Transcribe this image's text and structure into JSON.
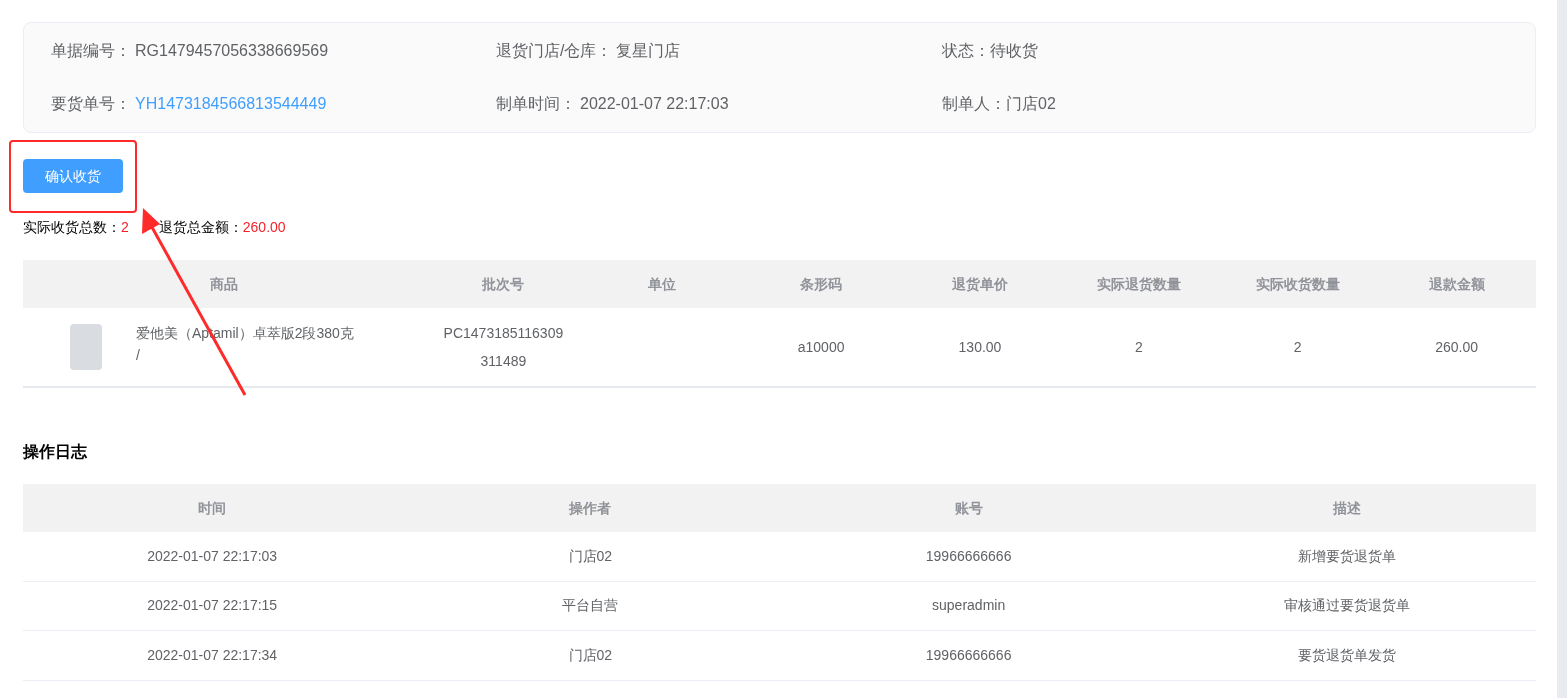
{
  "info": [
    {
      "label": "单据编号：",
      "value": "RG1479457056338669569",
      "kind": "plain"
    },
    {
      "label": "退货门店/仓库：",
      "value": "复星门店",
      "kind": "plain"
    },
    {
      "label": "状态：",
      "value": "待收货",
      "kind": "plain"
    },
    {
      "label": "要货单号：",
      "value": "YH1473184566813544449",
      "kind": "link"
    },
    {
      "label": "制单时间：",
      "value": "2022-01-07 22:17:03",
      "kind": "plain"
    },
    {
      "label": "制单人：",
      "value": "门店02",
      "kind": "plain"
    }
  ],
  "confirm_button": "确认收货",
  "summary": [
    {
      "label": "实际收货总数：",
      "value": "2"
    },
    {
      "label": "退货总金额：",
      "value": "260.00"
    }
  ],
  "goods_table": {
    "columns": [
      "商品",
      "批次号",
      "单位",
      "条形码",
      "退货单价",
      "实际退货数量",
      "实际收货数量",
      "退款金额"
    ],
    "rows": [
      {
        "name": "爱他美（Aptamil）卓萃版2段380克",
        "spec": "/",
        "batch": "PC1473185116309 311489",
        "unit": "",
        "barcode": "a10000",
        "price": "130.00",
        "return_qty": "2",
        "received_qty": "2",
        "amount": "260.00"
      }
    ]
  },
  "log_title": "操作日志",
  "log_table": {
    "columns": [
      "时间",
      "操作者",
      "账号",
      "描述"
    ],
    "rows": [
      [
        "2022-01-07 22:17:03",
        "门店02",
        "19966666666",
        "新增要货退货单"
      ],
      [
        "2022-01-07 22:17:15",
        "平台自营",
        "superadmin",
        "审核通过要货退货单"
      ],
      [
        "2022-01-07 22:17:34",
        "门店02",
        "19966666666",
        "要货退货单发货"
      ]
    ]
  }
}
